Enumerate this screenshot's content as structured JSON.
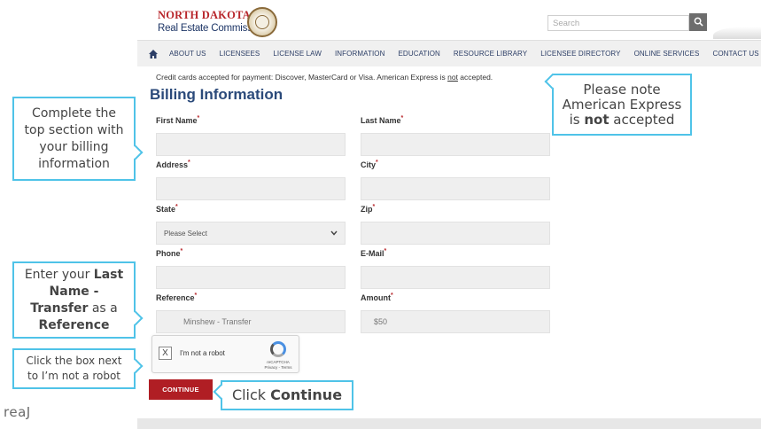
{
  "header": {
    "logo_line1": "NORTH DAKOTA",
    "logo_line2": "Real Estate Commission",
    "search_placeholder": "Search"
  },
  "nav": {
    "items": [
      "ABOUT US",
      "LICENSEES",
      "LICENSE LAW",
      "INFORMATION",
      "EDUCATION",
      "RESOURCE LIBRARY",
      "LICENSEE DIRECTORY",
      "ONLINE SERVICES",
      "CONTACT US"
    ]
  },
  "notice": {
    "text_before": "Credit cards accepted for payment: Discover, MasterCard or Visa.  American Express is ",
    "text_emph": "not",
    "text_after": " accepted."
  },
  "form": {
    "title": "Billing Information",
    "required_mark": "*",
    "first_name_label": "First Name",
    "last_name_label": "Last Name",
    "address_label": "Address",
    "city_label": "City",
    "state_label": "State",
    "state_value": "Please Select",
    "zip_label": "Zip",
    "phone_label": "Phone",
    "email_label": "E-Mail",
    "reference_label": "Reference",
    "reference_value": "Minshew - Transfer",
    "amount_label": "Amount",
    "amount_value": "$50"
  },
  "captcha": {
    "checkbox_mark": "X",
    "label": "I'm not a robot",
    "brand": "reCAPTCHA",
    "brand_links": "Privacy - Terms"
  },
  "continue_label": "CONTINUE",
  "callouts": {
    "amex_line1": "Please note",
    "amex_line2": "American Express",
    "amex_line3_pre": "is ",
    "amex_line3_bold": "not",
    "amex_line3_post": " accepted",
    "top_section": [
      "Complete the",
      "top section with",
      "your billing",
      "information"
    ],
    "reference_pre": "Enter your ",
    "reference_bold1": "Last",
    "reference_bold2": "Name -",
    "reference_bold3": "Transfer",
    "reference_mid": " as a",
    "reference_bold4": "Reference",
    "robot_line1": "Click the box next",
    "robot_line2": "to I’m not a robot",
    "continue_pre": "Click ",
    "continue_bold": "Continue"
  },
  "brand": "reaJ",
  "colors": {
    "callout_border": "#4fc3e8",
    "continue_button": "#b01e24",
    "title_blue": "#2b4a7a",
    "logo_red": "#b8262b"
  }
}
